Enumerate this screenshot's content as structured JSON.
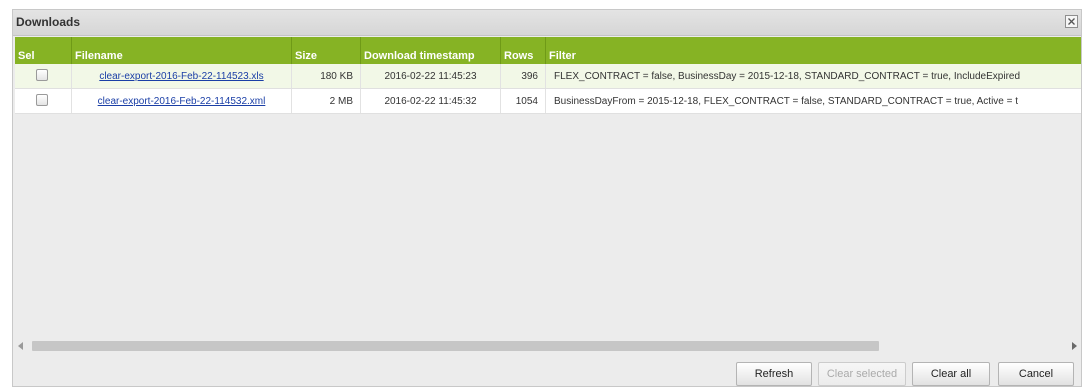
{
  "window": {
    "title": "Downloads"
  },
  "grid": {
    "columns": [
      "Sel",
      "Filename",
      "Size",
      "Download timestamp",
      "Rows",
      "Filter"
    ],
    "rows": [
      {
        "selected": false,
        "filename": "clear-export-2016-Feb-22-114523.xls",
        "size": "180 KB",
        "timestamp": "2016-02-22 11:45:23",
        "rows": "396",
        "filter": "FLEX_CONTRACT = false, BusinessDay = 2015-12-18, STANDARD_CONTRACT = true, IncludeExpired"
      },
      {
        "selected": false,
        "filename": "clear-export-2016-Feb-22-114532.xml",
        "size": "2 MB",
        "timestamp": "2016-02-22 11:45:32",
        "rows": "1054",
        "filter": "BusinessDayFrom = 2015-12-18, FLEX_CONTRACT = false, STANDARD_CONTRACT = true, Active = t"
      }
    ]
  },
  "buttons": {
    "refresh": "Refresh",
    "clear_selected": "Clear selected",
    "clear_all": "Clear all",
    "cancel": "Cancel"
  },
  "icons": {
    "close": "close-icon",
    "scroll_left": "scroll-left-arrow-icon",
    "scroll_right": "scroll-right-arrow-icon"
  },
  "colors": {
    "header_bg": "#86b324",
    "link": "#1a3ea6",
    "odd_row": "#f2f8e7"
  }
}
